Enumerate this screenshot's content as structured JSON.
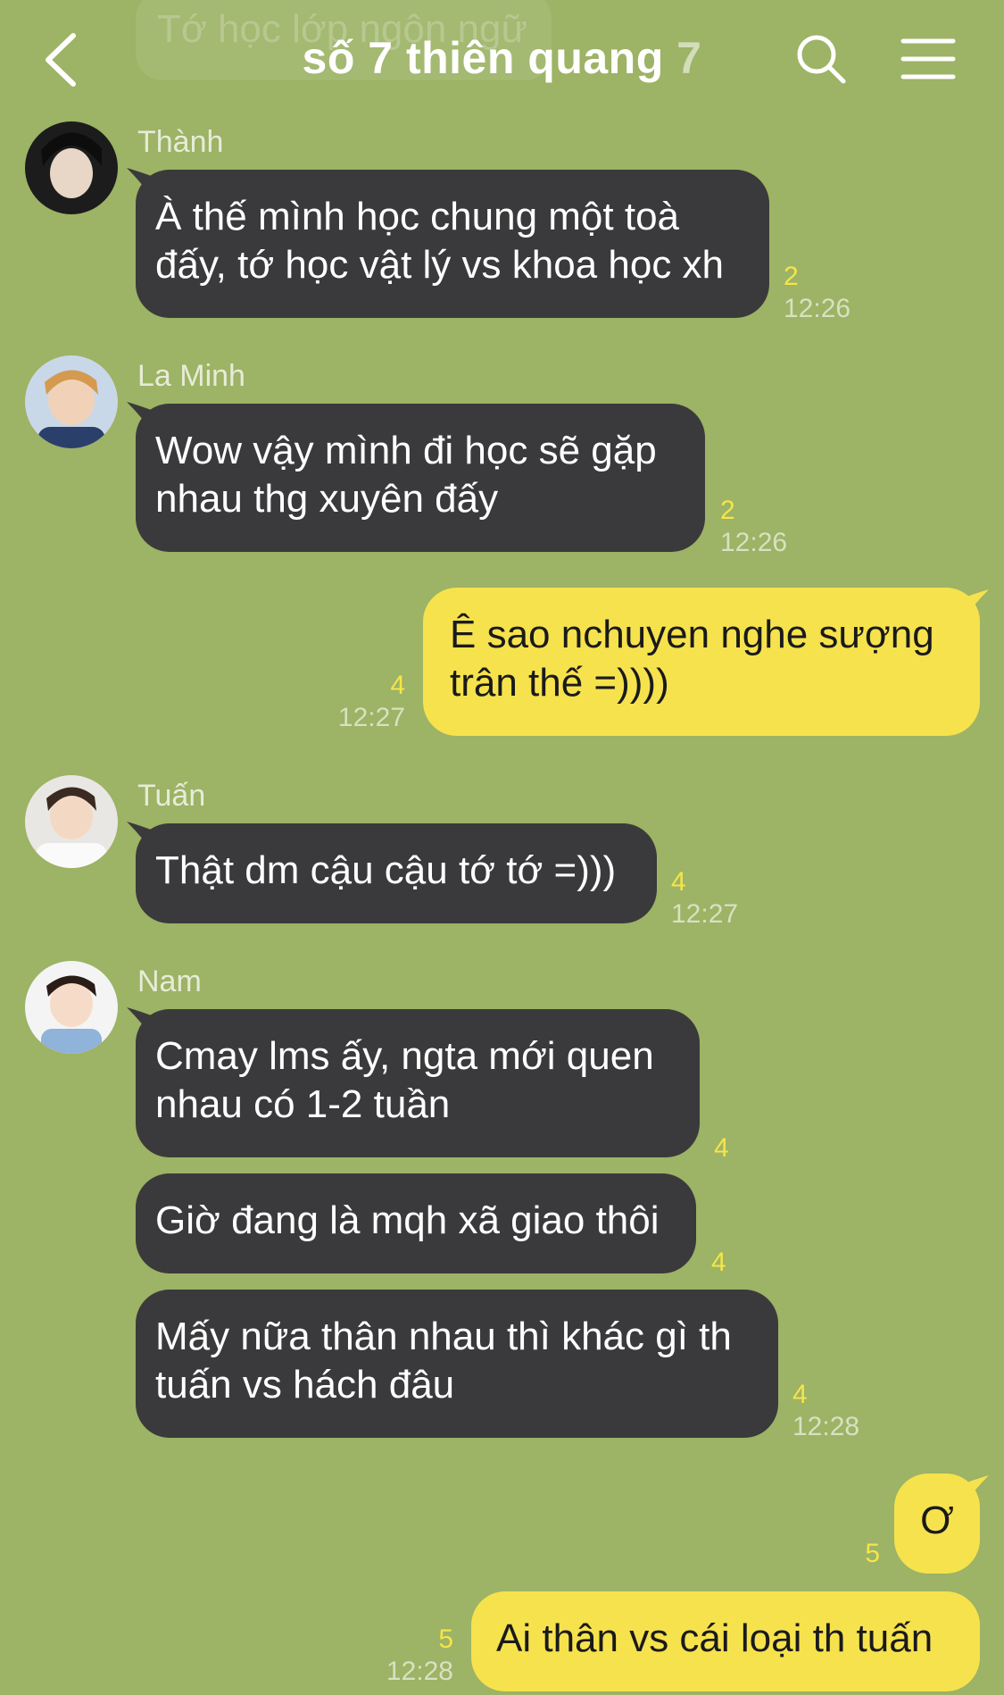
{
  "header": {
    "faded_preview": "Tớ học lớp ngôn ngữ",
    "title": "số 7 thiên quang",
    "member_count": "7"
  },
  "messages": [
    {
      "sender": "Thành",
      "text": "À thế mình học chung một toà\nđấy, tớ học vật lý vs khoa học xh",
      "read": "2",
      "time": "12:26"
    },
    {
      "sender": "La Minh",
      "text": "Wow vậy mình đi học sẽ gặp\nnhau thg xuyên đấy",
      "read": "2",
      "time": "12:26"
    },
    {
      "sender": "me",
      "text": "Ê sao nchuyen nghe sượng\ntrân thế =))))",
      "read": "4",
      "time": "12:27"
    },
    {
      "sender": "Tuấn",
      "text": "Thật dm cậu cậu tớ tớ =)))",
      "read": "4",
      "time": "12:27"
    },
    {
      "sender": "Nam",
      "text": "Cmay lms ấy, ngta mới quen\nnhau có 1-2 tuần",
      "read": "4",
      "time": ""
    },
    {
      "sender": "Nam",
      "text": "Giờ đang là mqh xã giao thôi",
      "read": "4",
      "time": ""
    },
    {
      "sender": "Nam",
      "text": "Mấy nữa thân nhau thì khác gì th\ntuấn vs hách đâu",
      "read": "4",
      "time": "12:28"
    },
    {
      "sender": "me",
      "text": "Ơ",
      "read": "5",
      "time": ""
    },
    {
      "sender": "me",
      "text": "Ai thân vs cái loại th tuấn",
      "read": "5",
      "time": "12:28"
    }
  ],
  "colors": {
    "background": "#9db365",
    "incoming_bubble": "#3a3a3c",
    "outgoing_bubble": "#f6e24d",
    "read_count": "#f5e54a"
  },
  "icons": [
    "back-arrow-icon",
    "search-icon",
    "menu-icon"
  ]
}
